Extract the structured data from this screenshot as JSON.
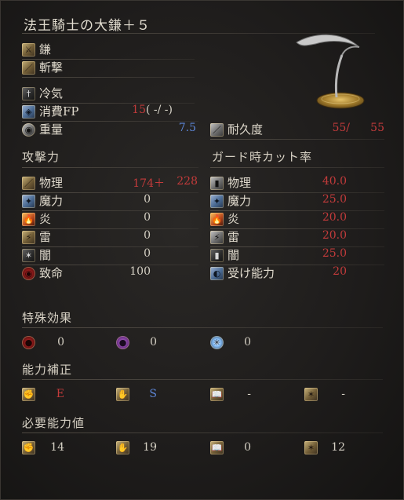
{
  "title": "法王騎士の大鎌＋５",
  "info": {
    "weapon_type": "鎌",
    "attack_type": "斬撃",
    "infusion": "冷気",
    "fp_cost_label": "消費FP",
    "fp_cost_value": "15",
    "fp_cost_extra": "(  -/  -)",
    "weight_label": "重量",
    "weight_value": "7.5",
    "durability_label": "耐久度",
    "durability_current": "55/",
    "durability_max": "55"
  },
  "attack": {
    "header": "攻撃力",
    "rows": [
      {
        "label": "物理",
        "value": "174＋",
        "bonus": "228"
      },
      {
        "label": "魔力",
        "value": "0"
      },
      {
        "label": "炎",
        "value": "0"
      },
      {
        "label": "雷",
        "value": "0"
      },
      {
        "label": "闇",
        "value": "0"
      },
      {
        "label": "致命",
        "value": "100"
      }
    ]
  },
  "guard": {
    "header": "ガード時カット率",
    "rows": [
      {
        "label": "物理",
        "value": "40.0"
      },
      {
        "label": "魔力",
        "value": "25.0"
      },
      {
        "label": "炎",
        "value": "20.0"
      },
      {
        "label": "雷",
        "value": "20.0"
      },
      {
        "label": "闇",
        "value": "25.0"
      },
      {
        "label": "受け能力",
        "value": "20"
      }
    ]
  },
  "special": {
    "header": "特殊効果",
    "items": [
      {
        "icon": "bleed-icon",
        "value": "0"
      },
      {
        "icon": "poison-icon",
        "value": "0"
      },
      {
        "icon": "frost-icon",
        "value": "0"
      }
    ]
  },
  "scaling": {
    "header": "能力補正",
    "items": [
      {
        "icon": "strength-icon",
        "value": "E"
      },
      {
        "icon": "dexterity-icon",
        "value": "S"
      },
      {
        "icon": "intelligence-icon",
        "value": "-"
      },
      {
        "icon": "faith-icon",
        "value": "-"
      }
    ]
  },
  "requirements": {
    "header": "必要能力値",
    "items": [
      {
        "icon": "strength-icon",
        "value": "14"
      },
      {
        "icon": "dexterity-icon",
        "value": "19"
      },
      {
        "icon": "intelligence-icon",
        "value": "0"
      },
      {
        "icon": "faith-icon",
        "value": "12"
      }
    ]
  },
  "colors": {
    "red_value": "#c33b3b",
    "blue_value": "#5d86d6",
    "text": "#e0dacd"
  }
}
